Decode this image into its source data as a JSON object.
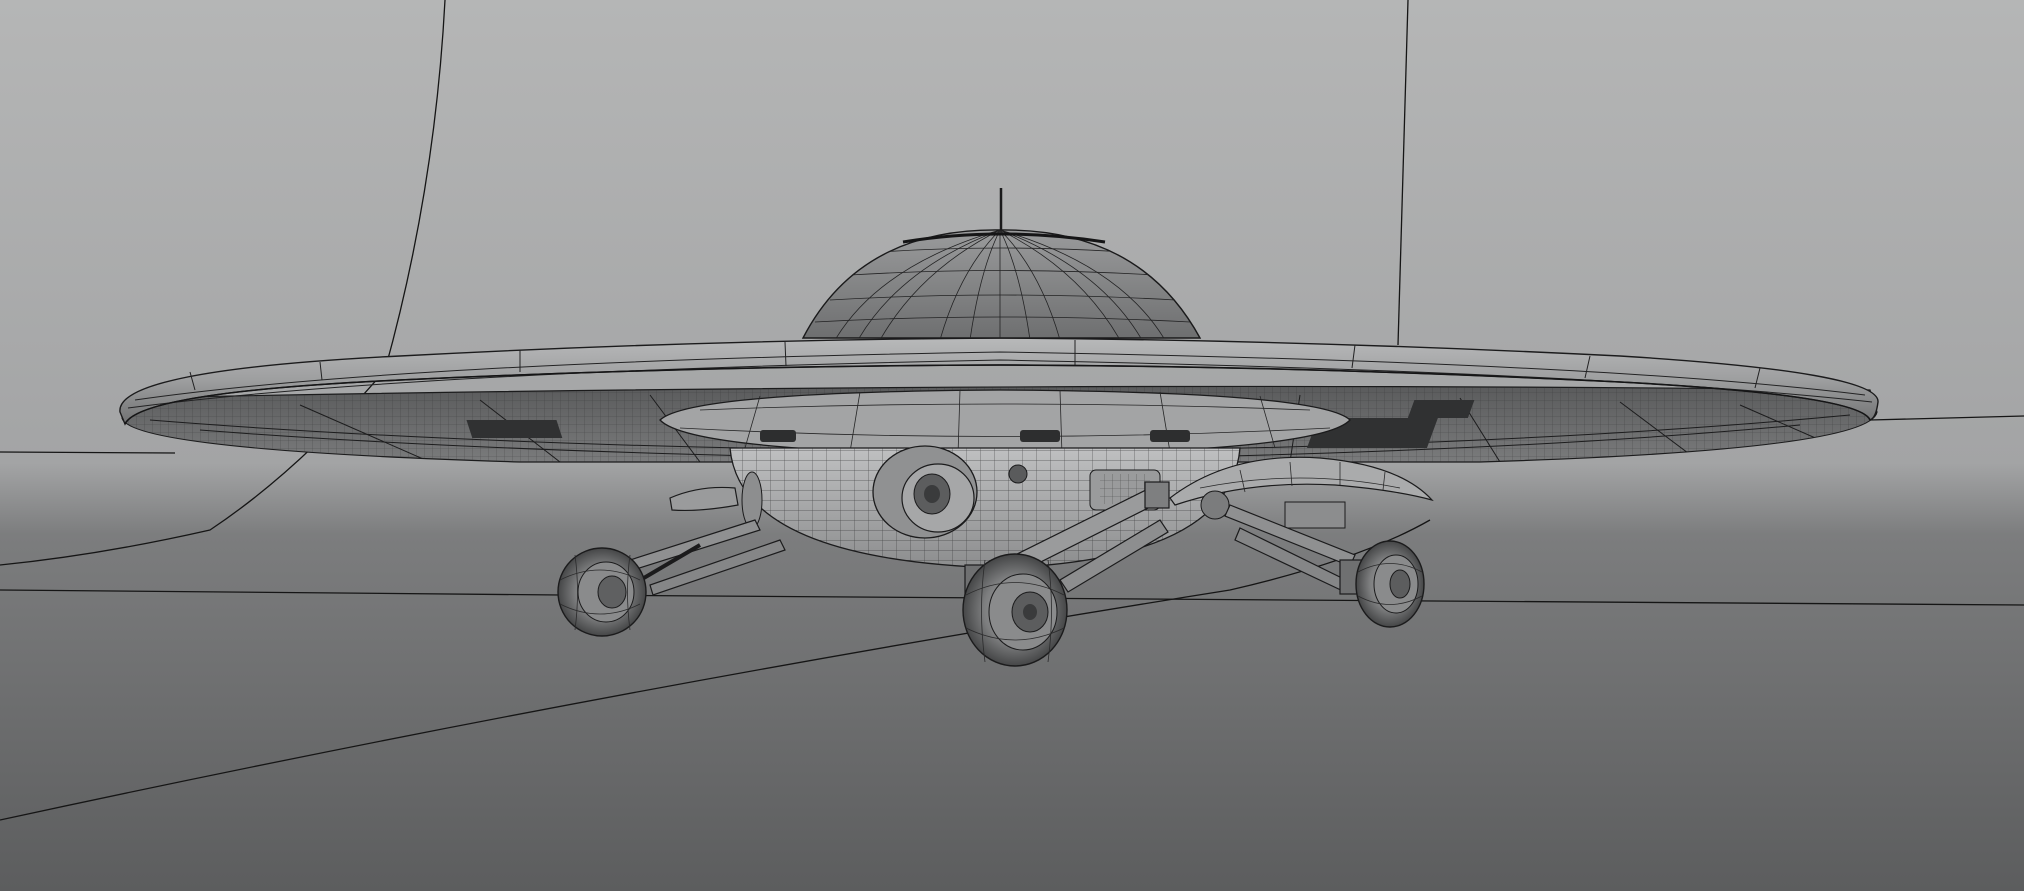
{
  "viewport": {
    "description_text": "",
    "colors": {
      "sky_top": "#b5b6b6",
      "sky_bottom": "#9c9d9e",
      "floor_top": "#7a7b7c",
      "floor_bottom": "#5e5f60",
      "mesh_light": "#a9aaab",
      "mesh_mid": "#8e8f90",
      "mesh_dark": "#4a4b4c",
      "wire": "#1e1e1f",
      "guide_line": "#111111"
    },
    "icons": [
      "ufo-model",
      "dome",
      "antenna",
      "saucer-rim",
      "landing-gear",
      "wheel"
    ]
  }
}
